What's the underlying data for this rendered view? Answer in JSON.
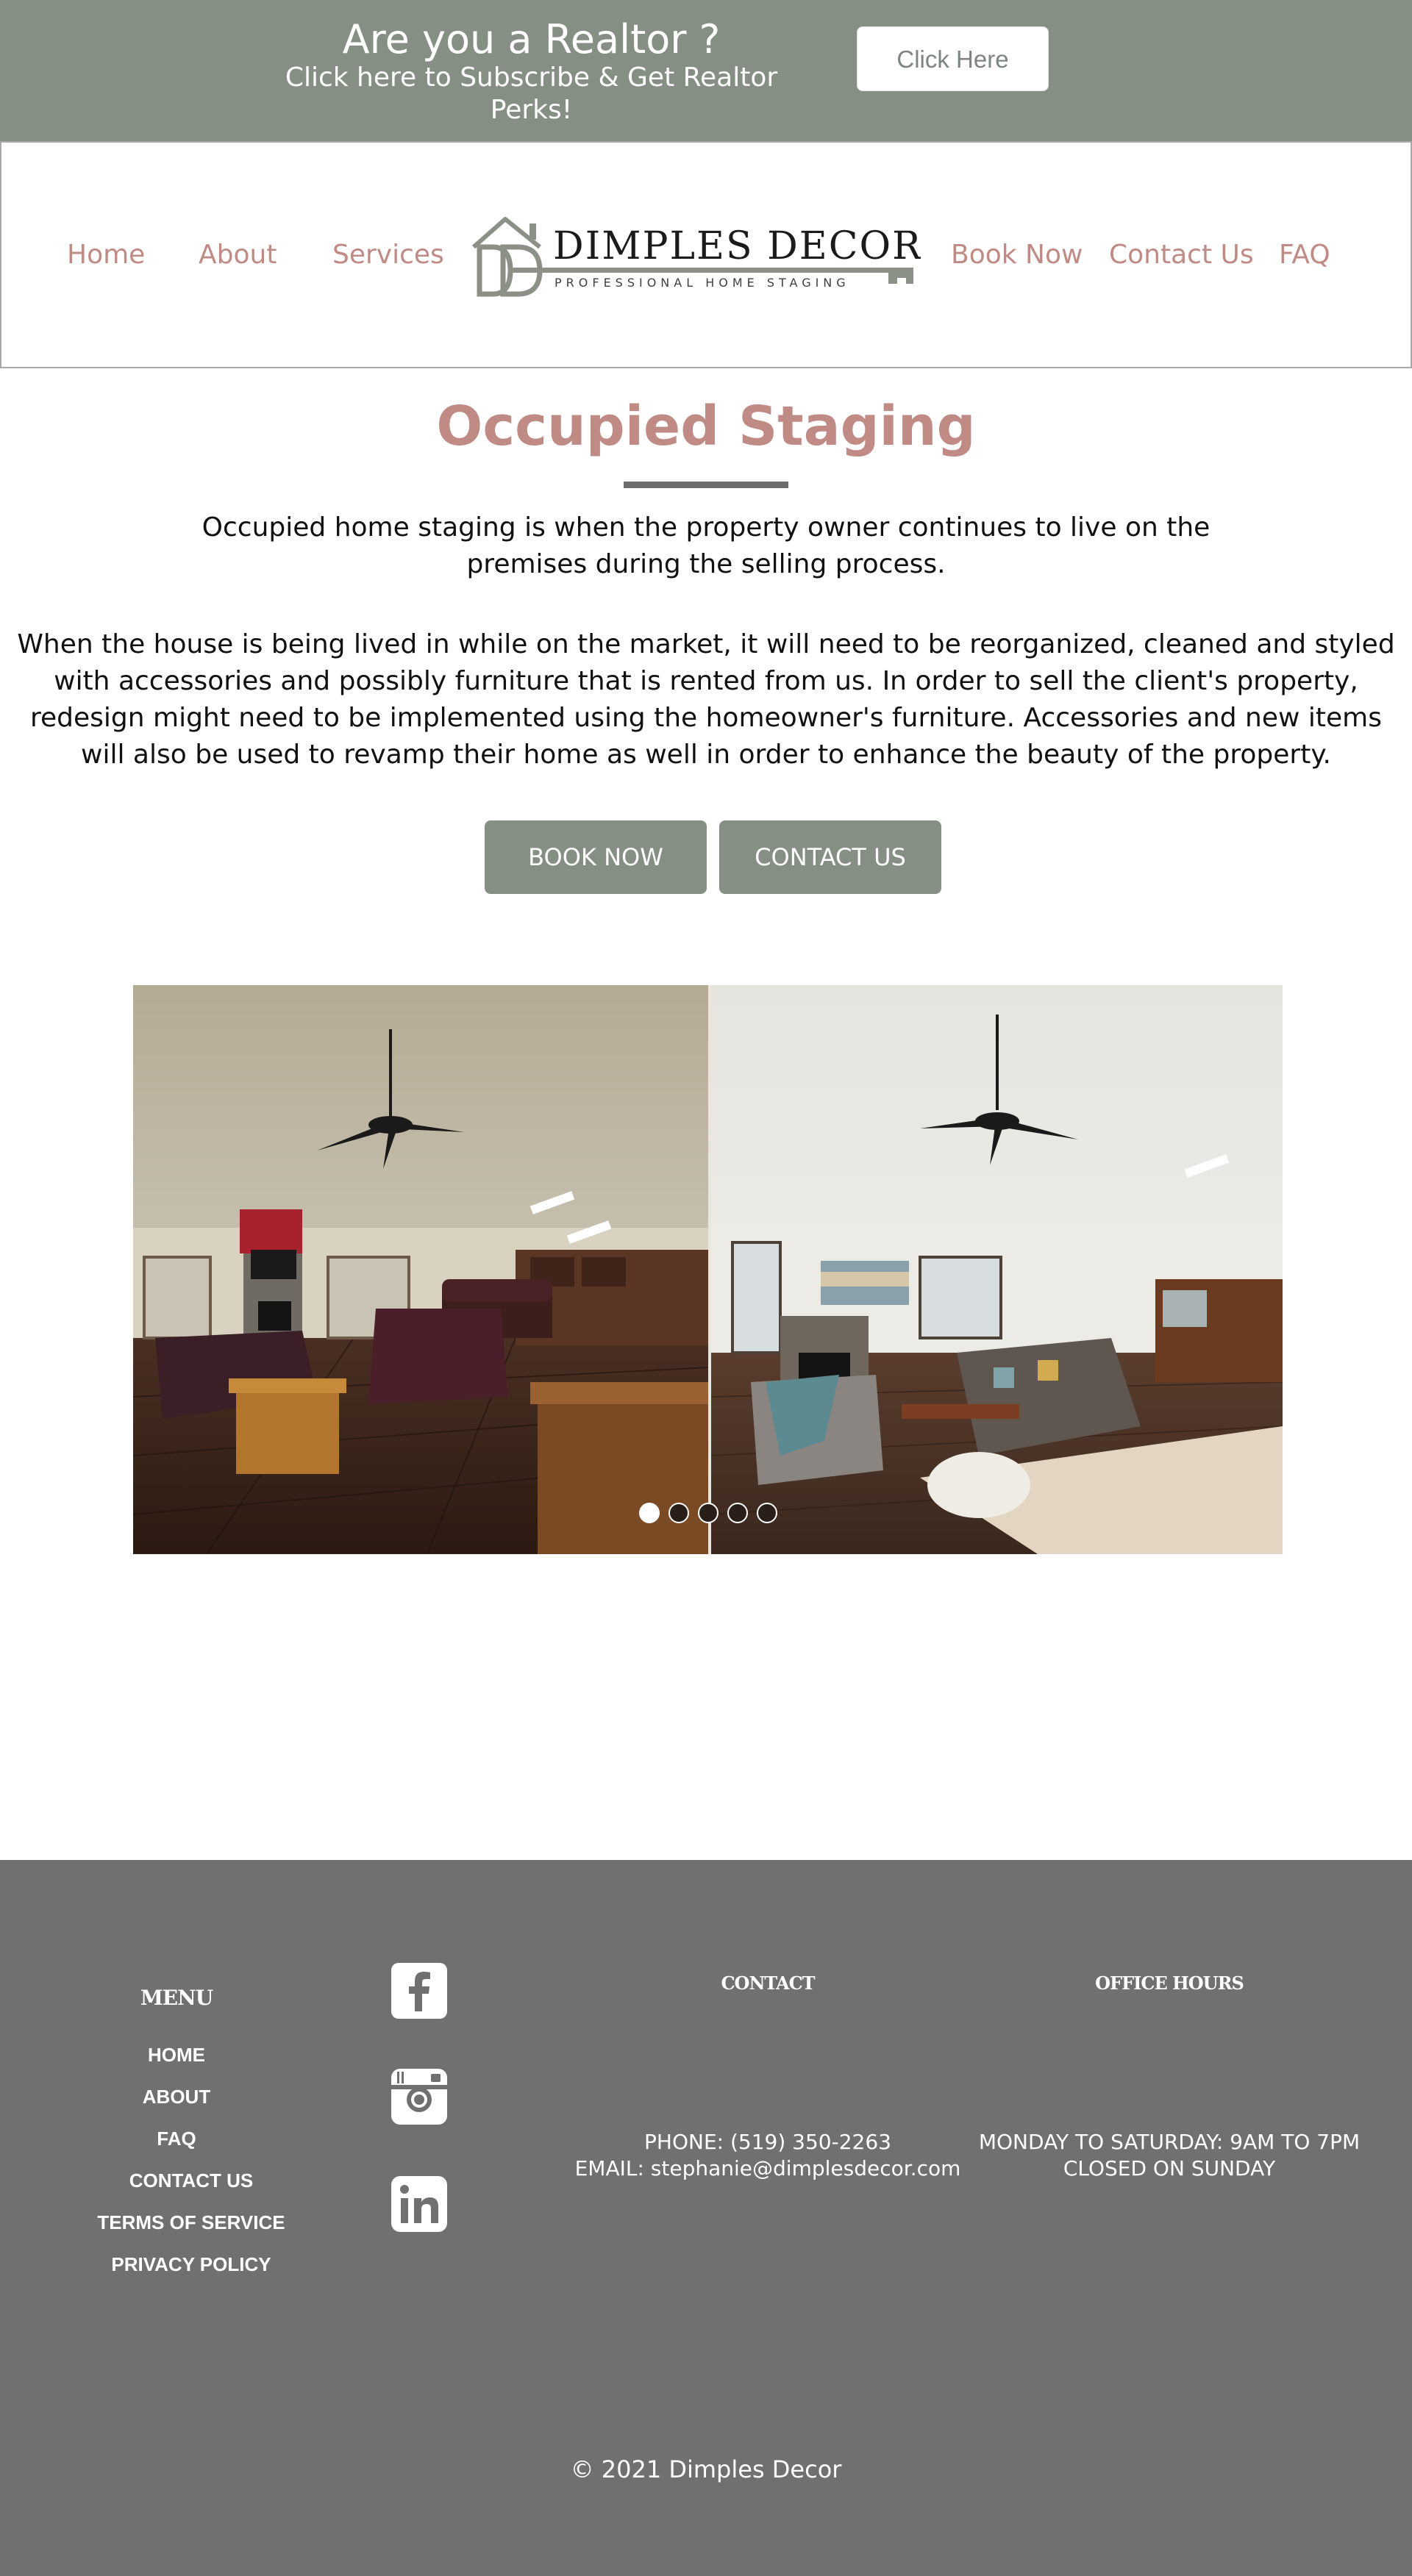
{
  "banner": {
    "title": "Are you a Realtor ?",
    "subtitle": "Click here to Subscribe & Get Realtor Perks!",
    "button_label": "Click Here"
  },
  "nav": {
    "home": "Home",
    "about": "About",
    "services": "Services",
    "book_now": "Book Now",
    "contact_us": "Contact Us",
    "faq": "FAQ"
  },
  "logo": {
    "name": "DIMPLES DECOR",
    "tagline": "PROFESSIONAL HOME STAGING"
  },
  "main": {
    "title": "Occupied Staging",
    "intro": "Occupied home staging is when the property owner continues to live on the premises during the selling process.",
    "body": "When the house is being lived in while on the market, it will need to be reorganized, cleaned and styled with accessories and possibly furniture that is rented from us. In order to sell the client's property, redesign might need to be implemented using the homeowner's furniture. Accessories and new items will also be used to revamp their home as well in order to enhance the beauty of the property.",
    "book_now_button": "BOOK NOW",
    "contact_us_button": "CONTACT US"
  },
  "slideshow": {
    "total_slides": 5,
    "active_slide": 1
  },
  "footer": {
    "menu_heading": "MENU",
    "menu_items": [
      "HOME",
      "ABOUT",
      "FAQ",
      "CONTACT US",
      "TERMS OF SERVICE",
      "PRIVACY POLICY"
    ],
    "social_icons": [
      "facebook-icon",
      "instagram-icon",
      "linkedin-icon"
    ],
    "contact_heading": "CONTACT",
    "phone": "PHONE: (519) 350-2263",
    "email": "EMAIL: stephanie@dimplesdecor.com",
    "hours_heading": "OFFICE HOURS",
    "hours_weekdays": "MONDAY TO SATURDAY: 9AM TO 7PM",
    "hours_sunday": "CLOSED ON SUNDAY",
    "copyright": "© 2021 Dimples Decor"
  },
  "colors": {
    "brand_sage": "#858f84",
    "accent_rose": "#c08a85",
    "footer_gray": "#707070"
  }
}
